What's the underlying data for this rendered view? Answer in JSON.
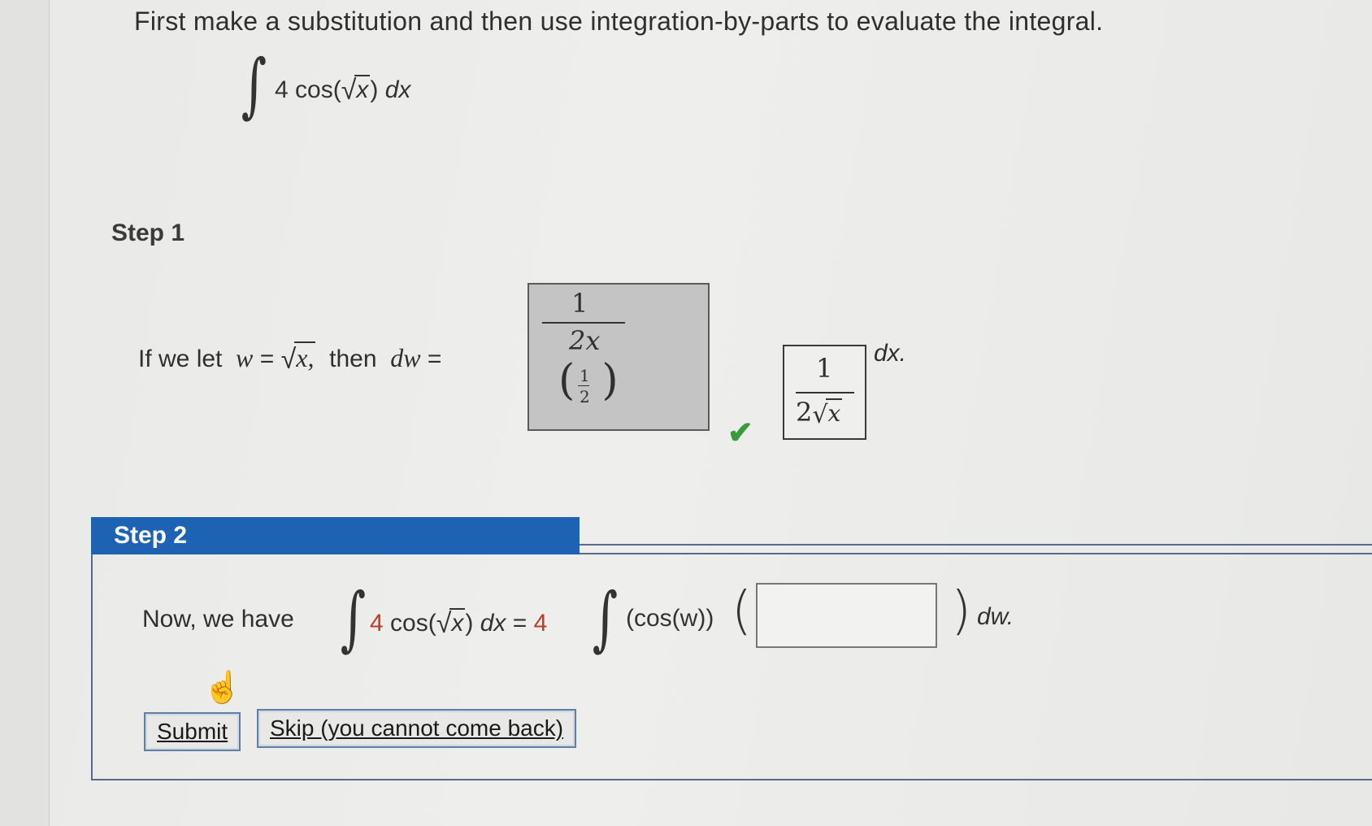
{
  "question": "First make a substitution and then use integration-by-parts to evaluate the integral.",
  "main_integral": {
    "coef": "4",
    "func": "cos(",
    "arg": "x",
    "close": ")",
    "diff": "dx"
  },
  "step1": {
    "label": "Step 1",
    "prefix": "If we let",
    "w_var": "w",
    "equals": "=",
    "sqrt_arg": "x,",
    "then": "then",
    "dw": "dw",
    "eq2": "=",
    "entered_answer": {
      "numerator": "1",
      "denominator": "2x",
      "paren_frac_num": "1",
      "paren_frac_den": "2"
    },
    "correct_answer": {
      "numerator": "1",
      "denominator_coef": "2",
      "denominator_arg": "x"
    },
    "dx_suffix": "dx."
  },
  "step2": {
    "label": "Step 2",
    "prefix": "Now, we have",
    "lhs": {
      "coef": "4",
      "func": "cos(",
      "arg": "x",
      "close": ")",
      "diff": "dx"
    },
    "equals": "=",
    "rhs_coef": "4",
    "rhs_func": "(cos(w))",
    "input_value": "",
    "suffix": "dw."
  },
  "buttons": {
    "submit": "Submit",
    "skip": "Skip (you cannot come back)"
  },
  "colors": {
    "step_header": "#1e63b3",
    "check": "#3b9a3b",
    "math_red": "#c0392b"
  }
}
